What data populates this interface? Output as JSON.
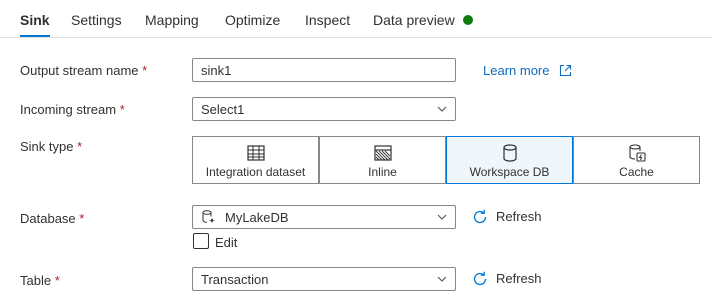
{
  "tabs": [
    {
      "label": "Sink"
    },
    {
      "label": "Settings"
    },
    {
      "label": "Mapping"
    },
    {
      "label": "Optimize"
    },
    {
      "label": "Inspect"
    },
    {
      "label": "Data preview"
    }
  ],
  "status_color": "#107c10",
  "form": {
    "output_stream": {
      "label": "Output stream name",
      "value": "sink1",
      "learn_more": "Learn more"
    },
    "incoming_stream": {
      "label": "Incoming stream",
      "value": "Select1"
    },
    "sink_type": {
      "label": "Sink type",
      "options": [
        {
          "label": "Integration dataset",
          "icon": "table-icon"
        },
        {
          "label": "Inline",
          "icon": "hatched-grid-icon"
        },
        {
          "label": "Workspace DB",
          "icon": "database-icon",
          "selected": true
        },
        {
          "label": "Cache",
          "icon": "cache-icon"
        }
      ]
    },
    "database": {
      "label": "Database",
      "value": "MyLakeDB",
      "refresh": "Refresh",
      "edit_label": "Edit",
      "edit_checked": false
    },
    "table": {
      "label": "Table",
      "value": "Transaction",
      "refresh": "Refresh"
    },
    "required_marker": "*"
  },
  "colors": {
    "accent": "#0078d4",
    "link": "#0f6cbd",
    "required": "#a4262c"
  }
}
